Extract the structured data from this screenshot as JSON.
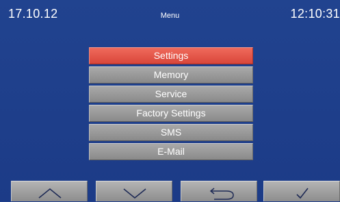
{
  "status_bar": {
    "date": "17.10.12",
    "title": "Menu",
    "time": "12:10:31"
  },
  "menu": {
    "items": [
      {
        "label": "Settings",
        "selected": true
      },
      {
        "label": "Memory",
        "selected": false
      },
      {
        "label": "Service",
        "selected": false
      },
      {
        "label": "Factory Settings",
        "selected": false
      },
      {
        "label": "SMS",
        "selected": false
      },
      {
        "label": "E-Mail",
        "selected": false
      }
    ]
  },
  "softkeys": [
    {
      "icon": "chevron-up-icon"
    },
    {
      "icon": "chevron-down-icon"
    },
    {
      "icon": "back-arrow-icon"
    },
    {
      "icon": "checkmark-icon"
    }
  ],
  "colors": {
    "background": "#1f3f8c",
    "selected_item": "#e0554a",
    "item": "#9a9a9a",
    "text": "#ffffff"
  }
}
